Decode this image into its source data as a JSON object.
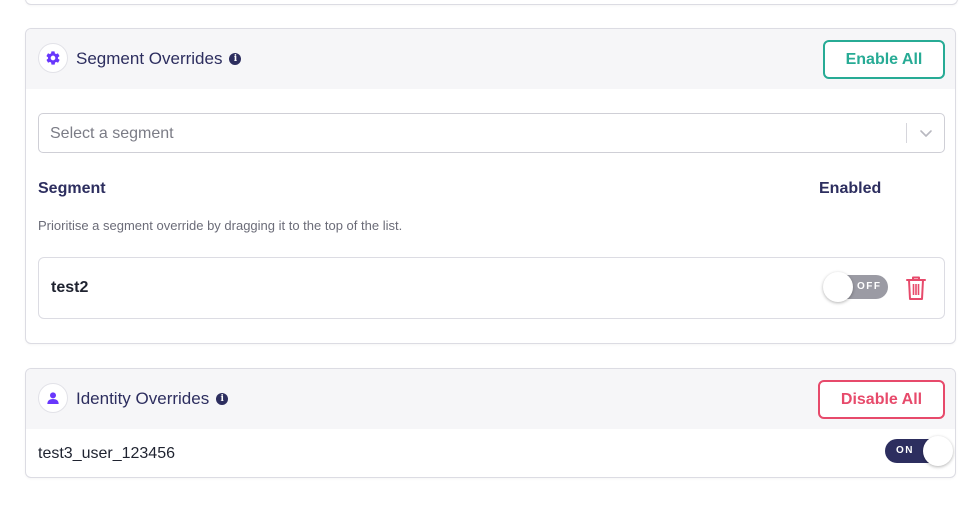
{
  "segment_overrides": {
    "title": "Segment Overrides",
    "enable_all_label": "Enable All",
    "select_placeholder": "Select a segment",
    "columns": {
      "segment": "Segment",
      "enabled": "Enabled"
    },
    "hint": "Prioritise a segment override by dragging it to the top of the list.",
    "rows": [
      {
        "name": "test2",
        "toggle_label": "OFF",
        "enabled": false
      }
    ]
  },
  "identity_overrides": {
    "title": "Identity Overrides",
    "disable_all_label": "Disable All",
    "rows": [
      {
        "name": "test3_user_123456",
        "toggle_label": "ON",
        "enabled": true
      }
    ]
  },
  "colors": {
    "primary": "#2d2e5f",
    "accent_purple": "#6837fc",
    "success": "#27ab95",
    "danger": "#e74a6b",
    "toggle_off": "#9b9ba4"
  },
  "icons": {
    "segment_header": "gear-icon",
    "identity_header": "user-icon",
    "info": "info-icon",
    "select_dropdown": "chevron-down-icon",
    "delete": "trash-icon"
  }
}
